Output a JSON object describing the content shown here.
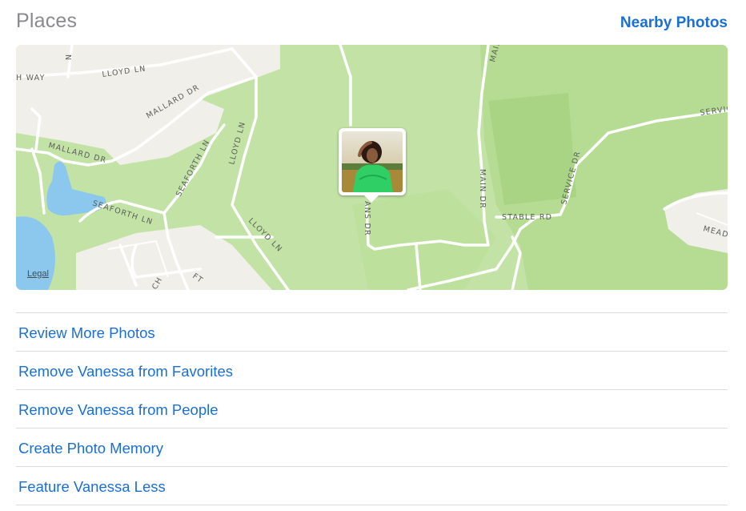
{
  "header": {
    "title": "Places",
    "nearby_link": "Nearby Photos"
  },
  "map": {
    "legal_link": "Legal",
    "pin_photo_icon": "person-photo-thumbnail",
    "road_labels": {
      "lloyd_ln_top": "LLOYD LN",
      "lloyd_ln_mid": "LLOYD LN",
      "lloyd_ln_low": "LLOYD LN",
      "way": "H WAY",
      "mallard_dr_1": "MALLARD DR",
      "mallard_dr_2": "MALLARD DR",
      "seaforth_ln_1": "SEAFORTH LN",
      "seaforth_ln_2": "SEAFORTH LN",
      "main_dr_top": "MAIN",
      "main_dr": "MAIN DR",
      "evans_dr": "ANS DR",
      "stable_rd": "STABLE RD",
      "service_dr": "SERVICE DR",
      "service_right": "SERVIC",
      "mead": "MEAD",
      "ft": "FT",
      "ch": "CH",
      "n": "N"
    },
    "colors": {
      "grass": "#c3e2a6",
      "park": "#b3d98f",
      "residential": "#f1efe9",
      "water": "#8cc8ee",
      "road": "#ffffff"
    }
  },
  "actions": [
    {
      "label": "Review More Photos"
    },
    {
      "label": "Remove Vanessa from Favorites"
    },
    {
      "label": "Remove Vanessa from People"
    },
    {
      "label": "Create Photo Memory"
    },
    {
      "label": "Feature Vanessa Less"
    }
  ],
  "accent_color": "#1a6fd6"
}
